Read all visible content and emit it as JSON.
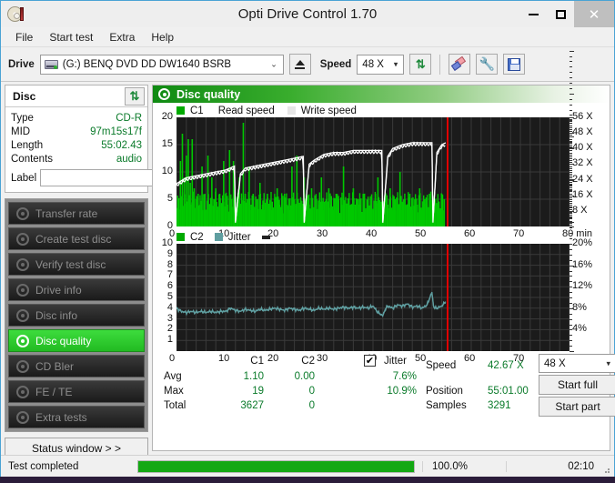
{
  "window": {
    "title": "Opti Drive Control 1.70",
    "icon": "disc-icon",
    "minimize": "–",
    "maximize": "□",
    "close": "✕"
  },
  "menu": {
    "items": [
      "File",
      "Start test",
      "Extra",
      "Help"
    ]
  },
  "toolbar": {
    "drive_label": "Drive",
    "drive_value": "(G:)   BENQ DVD DD DW1640 BSRB",
    "eject_icon": "eject-icon",
    "speed_label": "Speed",
    "speed_value": "48 X",
    "refresh_icon": "refresh-icon",
    "eraser_icon": "eraser-icon",
    "tools_icon": "tools-icon",
    "save_icon": "save-icon",
    "caret": "⌄"
  },
  "disc_panel": {
    "title": "Disc",
    "refresh_icon": "refresh-icon",
    "rows": [
      {
        "key": "Type",
        "value": "CD-R"
      },
      {
        "key": "MID",
        "value": "97m15s17f"
      },
      {
        "key": "Length",
        "value": "55:02.43"
      },
      {
        "key": "Contents",
        "value": "audio"
      }
    ],
    "label_key": "Label",
    "label_value": "",
    "label_placeholder": "",
    "cd_icon": "cd-icon"
  },
  "nav": {
    "items": [
      {
        "label": "Transfer rate",
        "icon": "disc-test-icon",
        "active": false
      },
      {
        "label": "Create test disc",
        "icon": "disc-create-icon",
        "active": false
      },
      {
        "label": "Verify test disc",
        "icon": "disc-verify-icon",
        "active": false
      },
      {
        "label": "Drive info",
        "icon": "drive-info-icon",
        "active": false
      },
      {
        "label": "Disc info",
        "icon": "disc-info-icon",
        "active": false
      },
      {
        "label": "Disc quality",
        "icon": "disc-quality-icon",
        "active": true
      },
      {
        "label": "CD Bler",
        "icon": "cd-bler-icon",
        "active": false
      },
      {
        "label": "FE / TE",
        "icon": "fe-te-icon",
        "active": false
      },
      {
        "label": "Extra tests",
        "icon": "extra-tests-icon",
        "active": false
      }
    ],
    "status_window": "Status window > >"
  },
  "quality": {
    "header": "Disc quality",
    "header_icon": "disc-quality-icon"
  },
  "stats": {
    "col_c1": "C1",
    "col_c2": "C2",
    "jitter_label": "Jitter",
    "jitter_checked": true,
    "check_glyph": "✔",
    "rows": [
      {
        "key": "Avg",
        "c1": "1.10",
        "c2": "0.00",
        "jitter": "7.6%"
      },
      {
        "key": "Max",
        "c1": "19",
        "c2": "0",
        "jitter": "10.9%"
      },
      {
        "key": "Total",
        "c1": "3627",
        "c2": "0",
        "jitter": ""
      }
    ],
    "speed_key": "Speed",
    "speed_value": "42.67 X",
    "position_key": "Position",
    "position_value": "55:01.00",
    "samples_key": "Samples",
    "samples_value": "3291",
    "speed_select": "48 X",
    "caret": "⌄",
    "start_full": "Start full",
    "start_part": "Start part"
  },
  "statusbar": {
    "text": "Test completed",
    "percent": "100.0%",
    "progress": 100,
    "time": "02:10"
  },
  "colors": {
    "accent_green": "#22bb22",
    "value_green": "#0a7a2a",
    "c1_green": "#00c800",
    "jitter_teal": "#5f9ea0",
    "read_speed_white": "#ffffff",
    "marker_red": "#e00000",
    "plot_bg": "#1b1b1b"
  },
  "chart_data": [
    {
      "type": "bar",
      "name": "c1-chart",
      "title": "",
      "xlabel": "min",
      "ylabel": "",
      "xlim": [
        0,
        80
      ],
      "ylim": [
        0,
        20
      ],
      "xticks": [
        0,
        10,
        20,
        30,
        40,
        50,
        60,
        70,
        80
      ],
      "xtick_labels": [
        "0",
        "10",
        "20",
        "30",
        "40",
        "50",
        "60",
        "70",
        "80 min"
      ],
      "yticks": [
        0,
        5,
        10,
        15,
        20
      ],
      "y2_label": "X",
      "y2lim": [
        0,
        56
      ],
      "y2ticks": [
        8,
        16,
        24,
        32,
        40,
        48,
        56
      ],
      "y2tick_labels": [
        "8 X",
        "16 X",
        "24 X",
        "32 X",
        "40 X",
        "48 X",
        "56 X"
      ],
      "grid": true,
      "legend": [
        "C1",
        "Read speed",
        "Write speed"
      ],
      "legend_colors": [
        "#00c800",
        "#ffffff",
        "#e6e6e6"
      ],
      "marker_x": 55,
      "series": [
        {
          "name": "C1",
          "kind": "bar",
          "color": "#00c800",
          "x": [
            0.3,
            0.8,
            1.2,
            1.6,
            2.0,
            2.4,
            2.8,
            3.2,
            3.6,
            4.0,
            4.4,
            4.8,
            5.2,
            5.6,
            6.0,
            6.4,
            6.8,
            7.2,
            7.6,
            8.0,
            8.4,
            8.8,
            9.2,
            9.6,
            10.0,
            10.4,
            10.8,
            11.2,
            11.6,
            12.0,
            12.4,
            12.8,
            13.2,
            13.6,
            14.0,
            14.4,
            14.8,
            15.2,
            15.6,
            16.0,
            16.5,
            17.0,
            17.5,
            18.0,
            18.5,
            19.0,
            19.5,
            20.0,
            20.5,
            21.0,
            21.5,
            22.0,
            22.5,
            23.0,
            23.5,
            24.0,
            24.5,
            25.0,
            25.5,
            26.0,
            26.5,
            27.0,
            27.5,
            28.0,
            28.5,
            29.0,
            29.5,
            30.0,
            30.5,
            31.0,
            31.5,
            32.0,
            32.5,
            33.0,
            33.5,
            34.0,
            34.5,
            35.0,
            35.5,
            36.0,
            36.5,
            37.0,
            37.5,
            38.0,
            38.5,
            39.0,
            39.5,
            40.0,
            40.5,
            41.0,
            41.5,
            42.0,
            42.5,
            43.0,
            43.5,
            44.0,
            44.5,
            45.0,
            45.5,
            46.0,
            46.5,
            47.0,
            47.5,
            48.0,
            48.5,
            49.0,
            49.5,
            50.0,
            50.5,
            51.0,
            51.5,
            52.0,
            52.5,
            53.0,
            53.5,
            54.0,
            54.5
          ],
          "values": [
            4,
            12,
            17,
            9,
            13,
            16,
            8,
            16,
            7,
            5,
            6,
            4,
            11,
            5,
            3,
            13,
            4,
            9,
            5,
            7,
            3,
            6,
            4,
            12,
            6,
            4,
            14,
            5,
            12,
            3,
            5,
            9,
            4,
            19,
            6,
            5,
            11,
            4,
            6,
            3,
            5,
            8,
            4,
            3,
            6,
            4,
            3,
            5,
            7,
            4,
            3,
            6,
            4,
            3,
            11,
            5,
            13,
            4,
            3,
            9,
            5,
            4,
            7,
            3,
            5,
            4,
            9,
            3,
            5,
            7,
            4,
            3,
            6,
            5,
            4,
            11,
            3,
            5,
            4,
            7,
            3,
            5,
            4,
            6,
            3,
            5,
            4,
            3,
            6,
            9,
            4,
            3,
            5,
            4,
            7,
            3,
            5,
            4,
            10,
            3,
            5,
            4,
            6,
            3,
            5,
            4,
            7,
            3,
            5,
            4,
            6,
            3,
            5,
            4,
            3,
            6,
            5
          ]
        },
        {
          "name": "Read speed",
          "kind": "line",
          "color": "#ffffff",
          "x": [
            0,
            2,
            4,
            6,
            8,
            10,
            11.8,
            12.0,
            13,
            14,
            16,
            18,
            20,
            22,
            24,
            25.8,
            26.0,
            27,
            28,
            30,
            32,
            34,
            36,
            38,
            40,
            41.8,
            42.0,
            43,
            44,
            46,
            48,
            50,
            52,
            52.2,
            53,
            54,
            54.8
          ],
          "values_x_speed": [
            22,
            25,
            26,
            27,
            28,
            29,
            31,
            2,
            27,
            30,
            31,
            32,
            33,
            34,
            35,
            36,
            2,
            32,
            34,
            37,
            38,
            38,
            39,
            39,
            39,
            39,
            2,
            36,
            40,
            42,
            43,
            43,
            43,
            2,
            38,
            42,
            43
          ]
        }
      ]
    },
    {
      "type": "line",
      "name": "c2-jitter-chart",
      "title": "",
      "xlabel": "min",
      "xlim": [
        0,
        80
      ],
      "ylim": [
        0,
        10
      ],
      "xticks": [
        0,
        10,
        20,
        30,
        40,
        50,
        60,
        70,
        80
      ],
      "xtick_labels": [
        "0",
        "10",
        "20",
        "30",
        "40",
        "50",
        "60",
        "70",
        "80 min"
      ],
      "yticks": [
        1,
        2,
        3,
        4,
        5,
        6,
        7,
        8,
        9,
        10
      ],
      "y2lim": [
        0,
        20
      ],
      "y2ticks": [
        4,
        8,
        12,
        16,
        20
      ],
      "y2tick_labels": [
        "4%",
        "8%",
        "12%",
        "16%",
        "20%"
      ],
      "grid": true,
      "legend": [
        "C2",
        "Jitter"
      ],
      "legend_colors": [
        "#00a000",
        "#5f9ea0"
      ],
      "marker_x": 55,
      "series": [
        {
          "name": "Jitter",
          "kind": "line",
          "color": "#5f9ea0",
          "x": [
            0,
            1,
            2,
            3,
            4,
            5,
            6,
            7,
            8,
            9,
            10,
            11,
            12,
            13,
            14,
            15,
            16,
            17,
            18,
            19,
            20,
            21,
            22,
            23,
            24,
            25,
            26,
            27,
            28,
            29,
            30,
            31,
            32,
            33,
            34,
            35,
            36,
            37,
            38,
            39,
            40,
            41,
            42,
            42.5,
            43,
            44,
            45,
            46,
            47,
            48,
            49,
            50,
            51,
            52,
            52.3,
            52.6,
            53,
            54,
            54.8
          ],
          "values": [
            4.0,
            3.7,
            3.6,
            3.7,
            3.6,
            3.7,
            3.6,
            3.7,
            3.6,
            3.7,
            3.7,
            4.0,
            3.8,
            3.7,
            3.9,
            3.8,
            3.7,
            3.9,
            3.8,
            3.9,
            4.0,
            3.9,
            3.8,
            4.0,
            3.9,
            3.8,
            4.0,
            3.9,
            3.8,
            4.0,
            3.9,
            4.0,
            3.9,
            4.0,
            4.1,
            4.0,
            4.1,
            4.0,
            4.1,
            4.0,
            4.2,
            3.6,
            3.3,
            3.9,
            4.2,
            4.0,
            4.3,
            4.2,
            4.4,
            4.1,
            4.2,
            4.0,
            4.3,
            5.5,
            4.2,
            4.0,
            4.0,
            4.2,
            4.6
          ]
        },
        {
          "name": "C2",
          "kind": "bar",
          "color": "#00a000",
          "x": [],
          "values": []
        }
      ]
    }
  ]
}
